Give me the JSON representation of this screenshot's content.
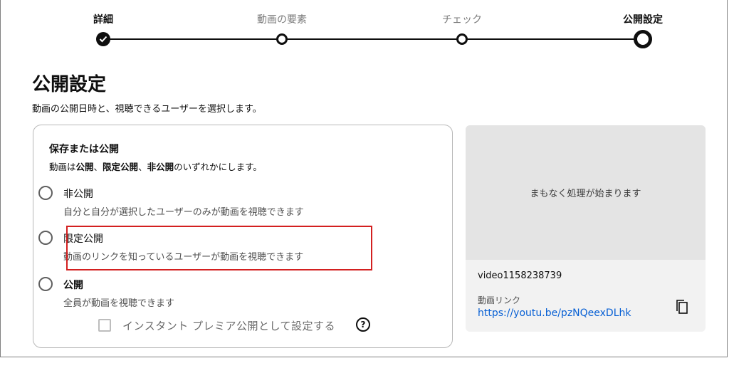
{
  "stepper": {
    "steps": [
      {
        "label": "詳細",
        "state": "done"
      },
      {
        "label": "動画の要素",
        "state": "pending"
      },
      {
        "label": "チェック",
        "state": "pending"
      },
      {
        "label": "公開設定",
        "state": "current"
      }
    ]
  },
  "page": {
    "title": "公開設定",
    "subtitle": "動画の公開日時と、視聴できるユーザーを選択します。"
  },
  "visibility": {
    "title": "保存または公開",
    "desc_prefix": "動画は",
    "desc_public": "公開",
    "desc_sep1": "、",
    "desc_unlisted": "限定公開",
    "desc_sep2": "、",
    "desc_private": "非公開",
    "desc_suffix": "のいずれかにします。",
    "options": [
      {
        "label": "非公開",
        "description": "自分と自分が選択したユーザーのみが動画を視聴できます"
      },
      {
        "label": "限定公開",
        "description": "動画のリンクを知っているユーザーが動画を視聴できます"
      },
      {
        "label": "公開",
        "description": "全員が動画を視聴できます"
      }
    ],
    "premiere_label": "インスタント プレミア公開として設定する",
    "help_glyph": "?"
  },
  "preview": {
    "processing_text": "まもなく処理が始まります",
    "video_id": "video1158238739",
    "link_label": "動画リンク",
    "link_url": "https://youtu.be/pzNQeexDLhk"
  },
  "icons": {
    "step_done": "checkmark-icon",
    "copy": "copy-icon",
    "help": "help-icon"
  },
  "colors": {
    "accent_link": "#065fd4",
    "highlight": "#d32020"
  }
}
